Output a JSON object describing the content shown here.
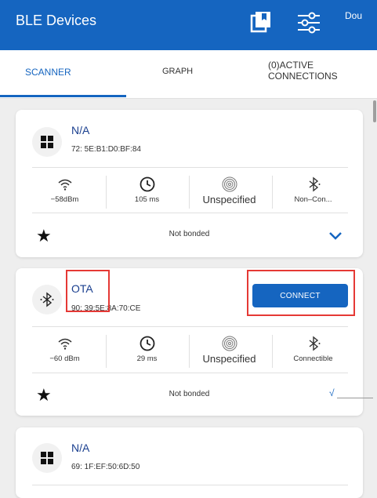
{
  "appbar": {
    "title": "BLE Devices",
    "user": "Dou"
  },
  "tabs": {
    "scanner": "SCANNER",
    "graph": "GRAPH",
    "active_line1": "(0)ACTIVE",
    "active_line2": "CONNECTIONS"
  },
  "devices": [
    {
      "name": "N/A",
      "mac": "72: 5E:B1:D0:BF:84",
      "rssi": "−58dBm",
      "interval": "105 ms",
      "type": "Unspecified",
      "connectable": "Non–Con...",
      "bonded": "Not bonded",
      "icon": "grid-icon"
    },
    {
      "name": "OTA",
      "mac": "90: 39:5E:8A:70:CE",
      "rssi": "−60 dBm",
      "interval": "29 ms",
      "type": "Unspecified",
      "connectable": "Connectible",
      "bonded": "Not bonded",
      "connect_label": "CONNECT",
      "icon": "bluetooth-icon",
      "check": "√"
    },
    {
      "name": "N/A",
      "mac": "69: 1F:EF:50:6D:50",
      "icon": "grid-icon"
    }
  ],
  "colors": {
    "primary": "#1565c0",
    "highlight": "#e53935",
    "background": "#eeeeee"
  }
}
